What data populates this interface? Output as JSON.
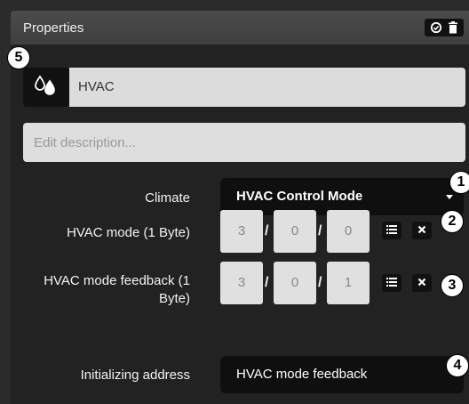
{
  "panel": {
    "title": "Properties"
  },
  "object": {
    "name": "HVAC",
    "description_placeholder": "Edit description...",
    "icon": "drops-icon"
  },
  "climate": {
    "label": "Climate",
    "selected": "HVAC Control Mode"
  },
  "hvac_mode": {
    "label": "HVAC mode (1 Byte)",
    "address": [
      "3",
      "0",
      "0"
    ]
  },
  "hvac_feedback": {
    "label_line1": "HVAC mode feedback (1",
    "label_line2": "Byte)",
    "address": [
      "3",
      "0",
      "1"
    ]
  },
  "init_address": {
    "label": "Initializing address",
    "selected": "HVAC mode feedback"
  },
  "callouts": [
    "1",
    "2",
    "3",
    "4",
    "5"
  ],
  "separator": "/",
  "icons": {
    "list": "list-icon",
    "clear": "x-icon",
    "check": "check-circle-icon",
    "trash": "trash-icon"
  }
}
